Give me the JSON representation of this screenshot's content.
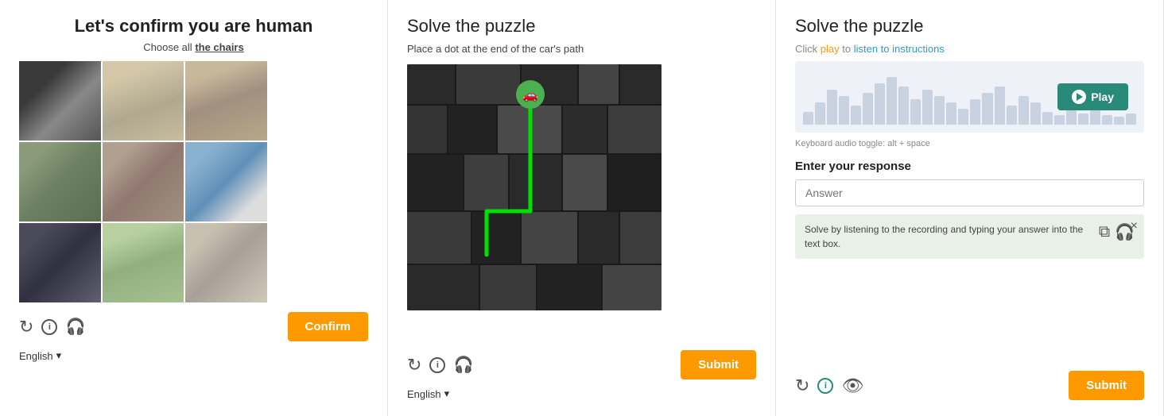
{
  "panel1": {
    "title": "Let's confirm you are human",
    "subtitle_pre": "Choose all ",
    "subtitle_highlight": "the chairs",
    "grid_cells": [
      {
        "id": 1,
        "label": "chair-outdoor-black",
        "selected": false
      },
      {
        "id": 2,
        "label": "chair-beige-recliner",
        "selected": false
      },
      {
        "id": 3,
        "label": "chair-cream",
        "selected": false
      },
      {
        "id": 4,
        "label": "chair-garden",
        "selected": false
      },
      {
        "id": 5,
        "label": "bed",
        "selected": false
      },
      {
        "id": 6,
        "label": "window-curtain",
        "selected": false
      },
      {
        "id": 7,
        "label": "chair-black-ornate",
        "selected": false
      },
      {
        "id": 8,
        "label": "chair-white-garden",
        "selected": false
      },
      {
        "id": 9,
        "label": "sofa-cushion",
        "selected": false
      }
    ],
    "confirm_label": "Confirm",
    "language": "English",
    "lang_dropdown_label": "English"
  },
  "panel2": {
    "title": "Solve the puzzle",
    "subtitle": "Place a dot at the end of the car's path",
    "submit_label": "Submit",
    "language": "English"
  },
  "panel3": {
    "title": "Solve the puzzle",
    "click_play_text": "Click play to listen to instructions",
    "play_label": "Play",
    "keyboard_hint": "Keyboard audio toggle: alt + space",
    "response_label": "Enter your response",
    "answer_placeholder": "Answer",
    "hint_text": "Solve by listening to the recording and typing your answer into the text box.",
    "submit_label": "Submit",
    "close_label": "×"
  },
  "icons": {
    "refresh": "↻",
    "info": "i",
    "headphones": "🎧",
    "eye": "👁",
    "chevron": "▾",
    "play_triangle": "▶",
    "close": "✕"
  },
  "colors": {
    "orange": "#f90",
    "teal": "#2a8a7a",
    "text_dark": "#222",
    "text_muted": "#888",
    "border": "#ccc"
  }
}
